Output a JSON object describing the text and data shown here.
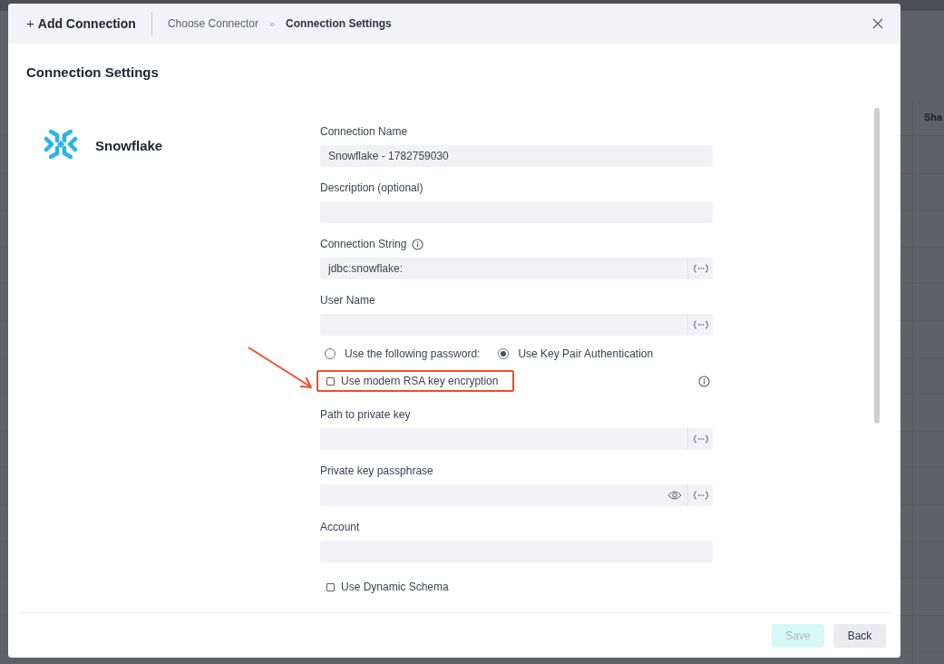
{
  "background": {
    "column_header": "Sha"
  },
  "dialog": {
    "add_icon": "+",
    "title": "Add Connection",
    "breadcrumb": [
      {
        "label": "Choose Connector",
        "selected": false
      },
      {
        "label": "Connection Settings",
        "selected": true
      }
    ],
    "breadcrumb_separator": "»",
    "heading": "Connection Settings",
    "connector": "Snowflake",
    "form": [
      {
        "kind": "field",
        "label": "Connection Name",
        "value": "Snowflake - 1782759030"
      },
      {
        "kind": "field",
        "label": "Description (optional)"
      },
      {
        "kind": "field",
        "label": "Connection String",
        "info": true,
        "value": "jdbc:snowflake:",
        "variables": true
      },
      {
        "kind": "field",
        "label": "User Name",
        "variables": true
      },
      {
        "kind": "radio",
        "options": [
          {
            "label": "Use the following password:",
            "selected": false
          },
          {
            "label": "Use Key Pair Authentication",
            "selected": true
          }
        ]
      },
      {
        "kind": "checkbox",
        "label": "Use modern RSA key encryption",
        "checked": false,
        "highlighted": true,
        "info": true
      },
      {
        "kind": "field",
        "label": "Path to private key",
        "variables": true
      },
      {
        "kind": "field",
        "label": "Private key passphrase",
        "reveal": true,
        "variables": true
      },
      {
        "kind": "field",
        "label": "Account"
      },
      {
        "kind": "checkbox",
        "label": "Use Dynamic Schema",
        "checked": false,
        "highlighted": false
      }
    ],
    "buttons": [
      {
        "label": "Save",
        "disabled": true
      },
      {
        "label": "Back",
        "disabled": false
      }
    ]
  },
  "annotation": {
    "arrow": true
  }
}
